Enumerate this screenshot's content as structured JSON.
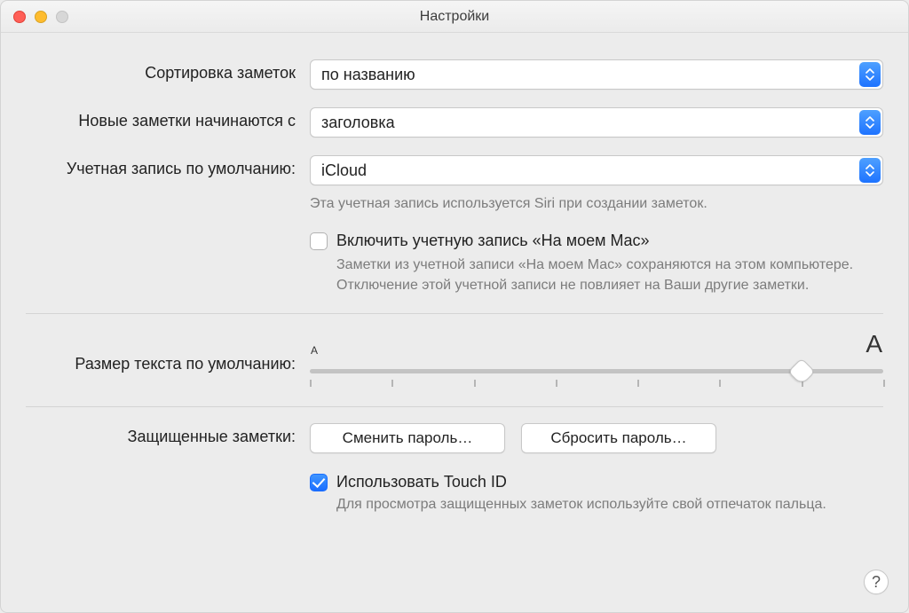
{
  "window": {
    "title": "Настройки"
  },
  "rows": {
    "sort": {
      "label": "Сортировка заметок",
      "value": "по названию"
    },
    "newNotes": {
      "label": "Новые заметки начинаются с",
      "value": "заголовка"
    },
    "defaultAccount": {
      "label": "Учетная запись по умолчанию:",
      "value": "iCloud",
      "hint": "Эта учетная запись используется Siri при создании заметок."
    },
    "enableLocal": {
      "label": "Включить учетную запись «На моем Mac»",
      "hint": "Заметки из учетной записи «На моем Мас» сохраняются на этом компьютере. Отключение этой учетной записи не повлияет на Ваши другие заметки.",
      "checked": false
    },
    "textSize": {
      "label": "Размер текста по умолчанию:",
      "minGlyph": "A",
      "maxGlyph": "A",
      "ticks": 8,
      "valueIndex": 6
    },
    "lockedNotes": {
      "label": "Защищенные заметки:",
      "changePassword": "Сменить пароль…",
      "resetPassword": "Сбросить пароль…"
    },
    "touchId": {
      "label": "Использовать Touch ID",
      "hint": "Для просмотра защищенных заметок используйте свой отпечаток пальца.",
      "checked": true
    }
  },
  "help": "?"
}
